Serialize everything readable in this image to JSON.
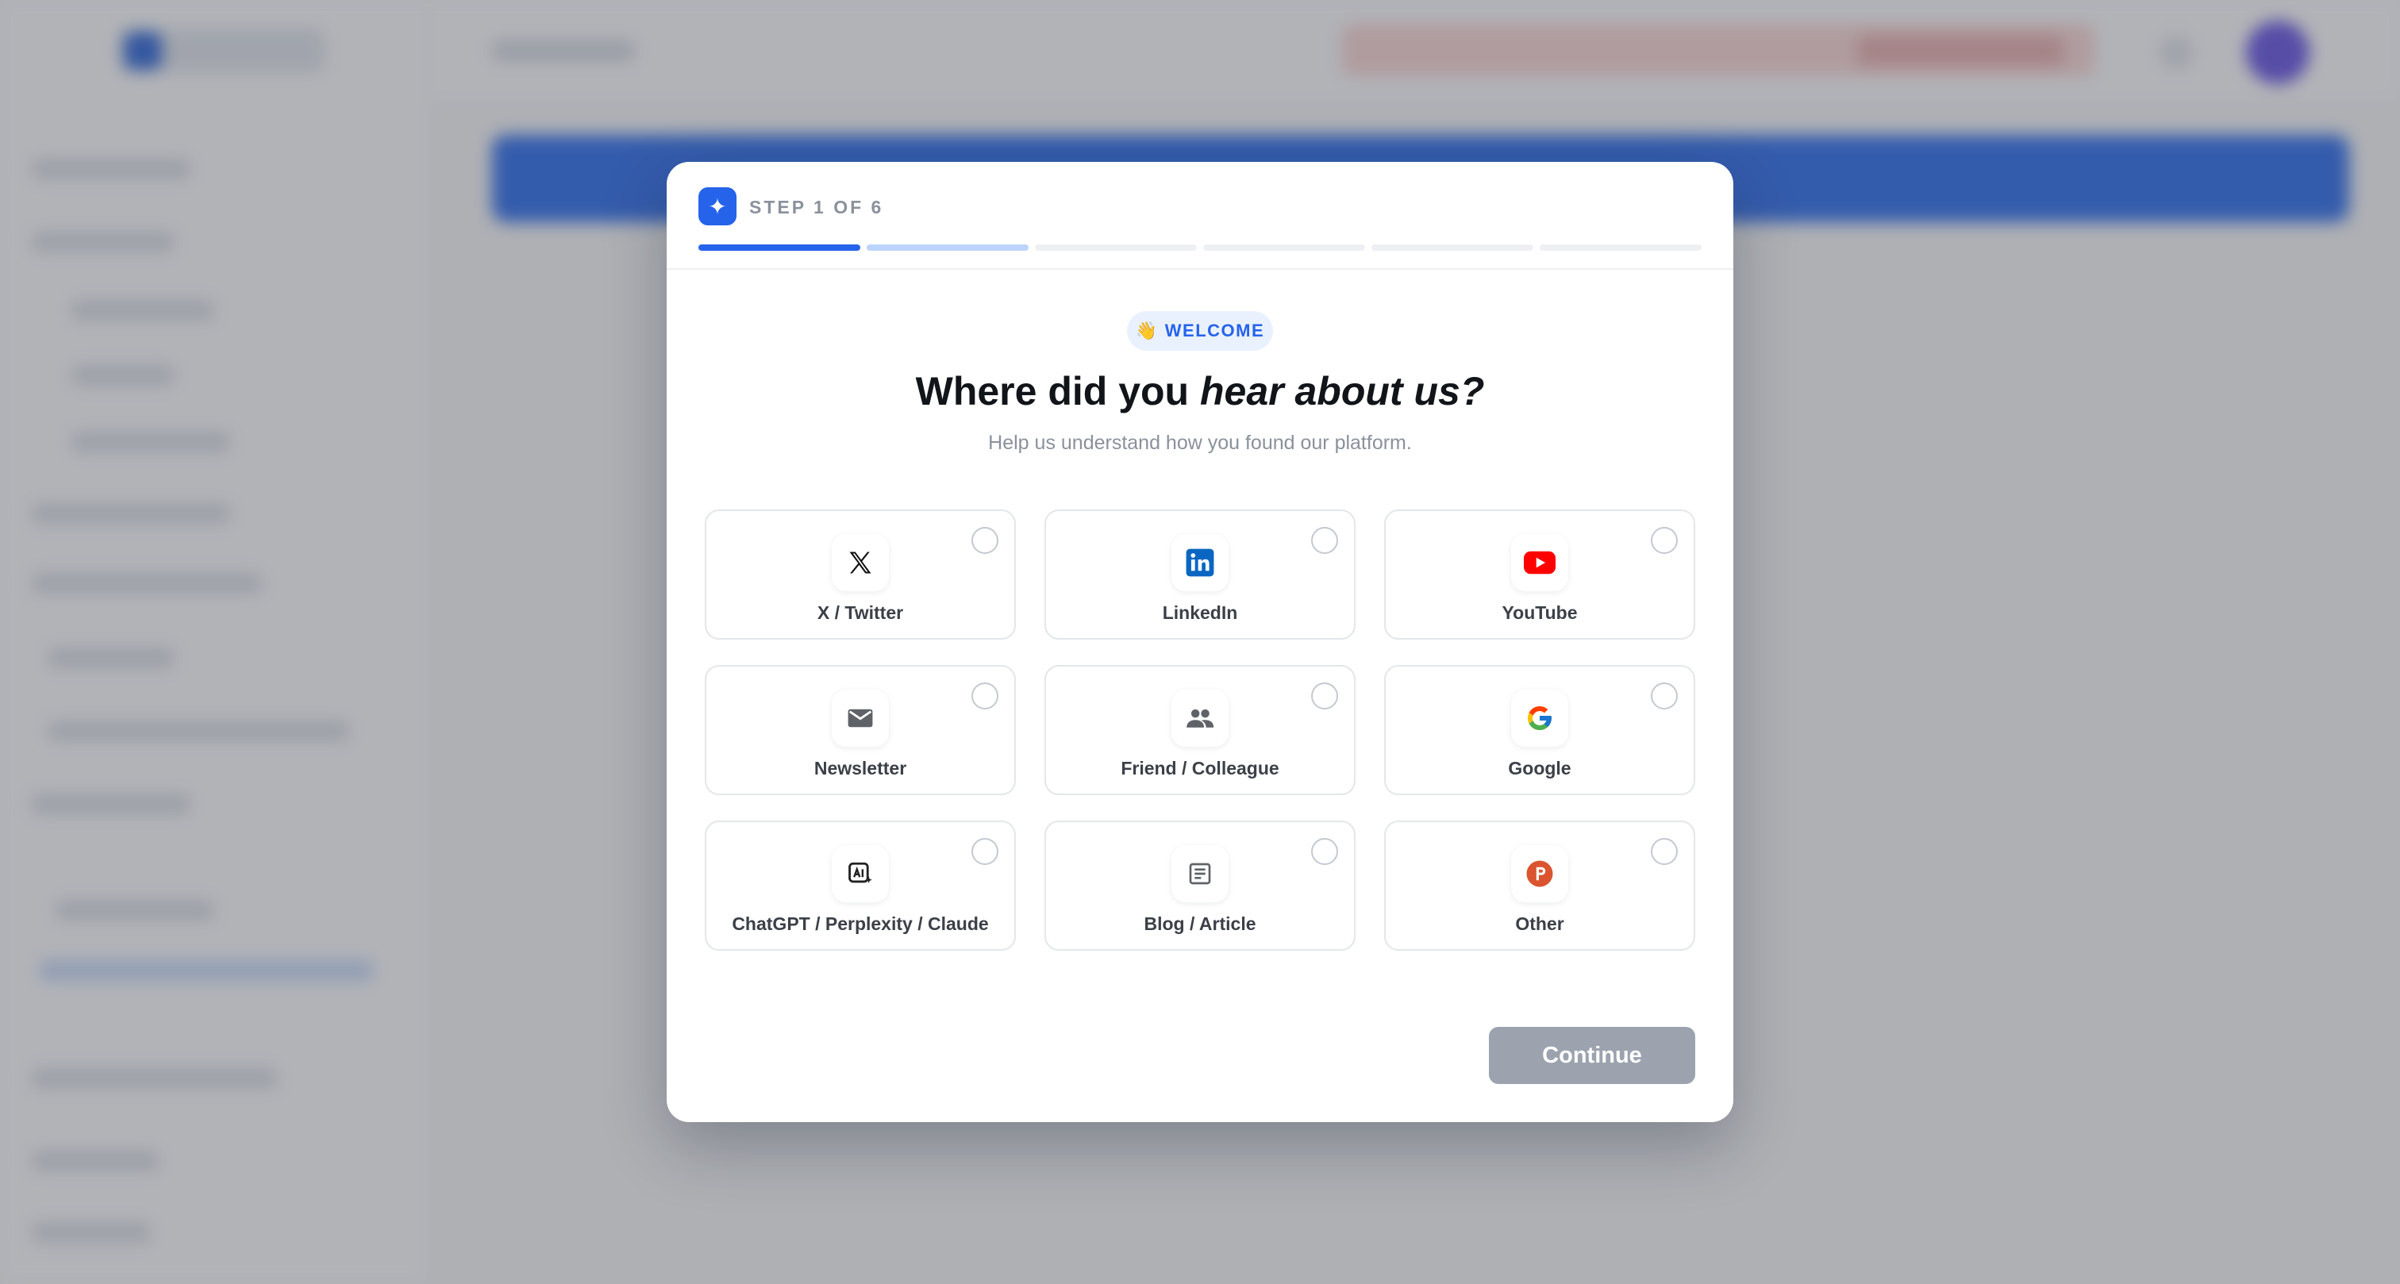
{
  "modal": {
    "step_label": "STEP 1 OF 6",
    "progress_current_step": 1,
    "progress_total_steps": 6,
    "badge_emoji": "👋",
    "badge_text": "WELCOME",
    "title_plain": "Where did you ",
    "title_emphasis": "hear about us?",
    "subtitle": "Help us understand how you found our platform.",
    "options": [
      {
        "label": "X / Twitter",
        "icon": "x-twitter-icon",
        "selected": false
      },
      {
        "label": "LinkedIn",
        "icon": "linkedin-icon",
        "selected": false
      },
      {
        "label": "YouTube",
        "icon": "youtube-icon",
        "selected": false
      },
      {
        "label": "Newsletter",
        "icon": "mail-icon",
        "selected": false
      },
      {
        "label": "Friend / Colleague",
        "icon": "people-icon",
        "selected": false
      },
      {
        "label": "Google",
        "icon": "google-icon",
        "selected": false
      },
      {
        "label": "ChatGPT / Perplexity / Claude",
        "icon": "ai-chat-icon",
        "selected": false
      },
      {
        "label": "Blog / Article",
        "icon": "article-icon",
        "selected": false
      },
      {
        "label": "Other",
        "icon": "product-hunt-icon",
        "selected": false
      }
    ],
    "continue_label": "Continue",
    "continue_enabled": false
  },
  "colors": {
    "accent": "#2563eb",
    "accent_light": "#bcd4fb",
    "disabled_button": "#9ca3af",
    "linkedin": "#0a66c2",
    "youtube": "#ff0000",
    "other": "#da552f"
  }
}
